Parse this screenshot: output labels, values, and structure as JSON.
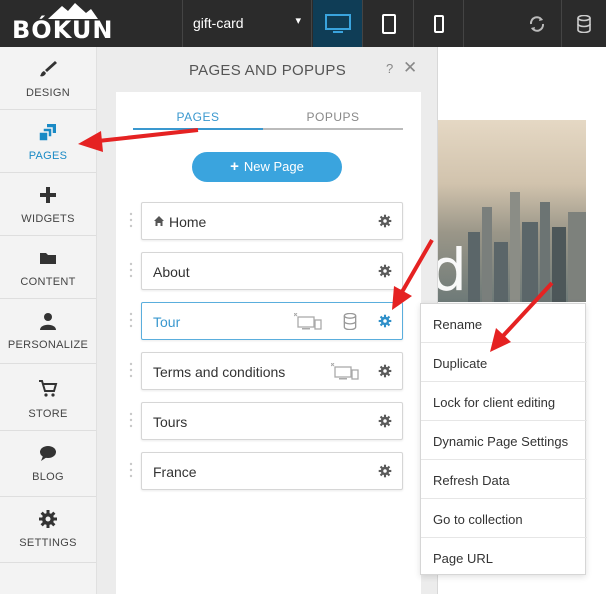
{
  "app": {
    "logo": "BÓKUN"
  },
  "topbar": {
    "site_name": "gift-card",
    "devices": [
      "desktop-icon",
      "tablet-icon",
      "phone-icon"
    ]
  },
  "sidebar": {
    "items": [
      {
        "label": "DESIGN",
        "icon": "brush-icon"
      },
      {
        "label": "PAGES",
        "icon": "pages-icon",
        "active": true
      },
      {
        "label": "WIDGETS",
        "icon": "plus-icon"
      },
      {
        "label": "CONTENT",
        "icon": "folder-icon"
      },
      {
        "label": "PERSONALIZE",
        "icon": "person-icon"
      },
      {
        "label": "STORE",
        "icon": "cart-icon"
      },
      {
        "label": "BLOG",
        "icon": "speech-bubble-icon"
      },
      {
        "label": "SETTINGS",
        "icon": "gear-icon"
      }
    ]
  },
  "panel": {
    "title": "PAGES AND POPUPS",
    "help": "?",
    "close": "✕",
    "tabs": [
      {
        "label": "PAGES",
        "active": true
      },
      {
        "label": "POPUPS"
      }
    ],
    "new_page_label": "New Page",
    "pages": [
      {
        "name": "Home"
      },
      {
        "name": "About"
      },
      {
        "name": "Tour"
      },
      {
        "name": "Terms and conditions"
      },
      {
        "name": "Tours"
      },
      {
        "name": "France"
      }
    ]
  },
  "preview": {
    "letter": "d"
  },
  "context_menu": {
    "items": [
      "Rename",
      "Duplicate",
      "Lock for client editing",
      "Dynamic Page Settings",
      "Refresh Data",
      "Go to collection",
      "Page URL"
    ]
  },
  "colors": {
    "accent": "#3aa4de",
    "topbar": "#2b2b2b",
    "annotation": "#e52222"
  }
}
